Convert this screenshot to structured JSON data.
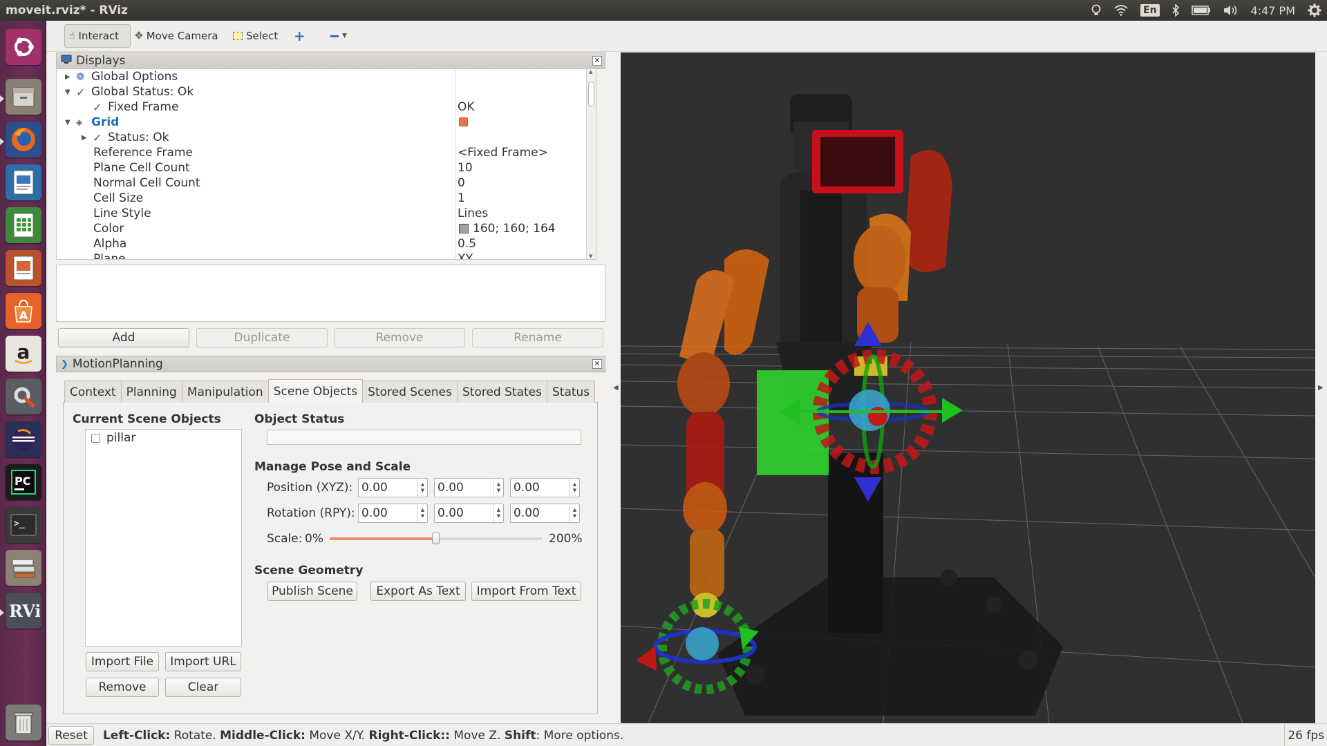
{
  "window": {
    "title": "moveit.rviz* - RViz"
  },
  "tray": {
    "lang": "En",
    "time": "4:47 PM"
  },
  "toolbar": {
    "interact": "Interact",
    "move_camera": "Move Camera",
    "select": "Select"
  },
  "displays": {
    "title": "Displays",
    "rows": [
      {
        "label": "Global Options",
        "value": ""
      },
      {
        "label": "Global Status: Ok",
        "value": ""
      },
      {
        "label": "Fixed Frame",
        "value": "OK"
      },
      {
        "label": "Grid",
        "value": ""
      },
      {
        "label": "Status: Ok",
        "value": ""
      },
      {
        "label": "Reference Frame",
        "value": "<Fixed Frame>"
      },
      {
        "label": "Plane Cell Count",
        "value": "10"
      },
      {
        "label": "Normal Cell Count",
        "value": "0"
      },
      {
        "label": "Cell Size",
        "value": "1"
      },
      {
        "label": "Line Style",
        "value": "Lines"
      },
      {
        "label": "Color",
        "value": "160; 160; 164"
      },
      {
        "label": "Alpha",
        "value": "0.5"
      },
      {
        "label": "Plane",
        "value": "XY"
      }
    ],
    "buttons": {
      "add": "Add",
      "duplicate": "Duplicate",
      "remove": "Remove",
      "rename": "Rename"
    }
  },
  "motion": {
    "title": "MotionPlanning",
    "tabs": [
      "Context",
      "Planning",
      "Manipulation",
      "Scene Objects",
      "Stored Scenes",
      "Stored States",
      "Status"
    ],
    "selected_tab": "Scene Objects",
    "current_objects_title": "Current Scene Objects",
    "objects": [
      "pillar"
    ],
    "object_status_title": "Object Status",
    "manage_title": "Manage Pose and Scale",
    "position_label": "Position (XYZ):",
    "rotation_label": "Rotation (RPY):",
    "position": [
      "0.00",
      "0.00",
      "0.00"
    ],
    "rotation": [
      "0.00",
      "0.00",
      "0.00"
    ],
    "scale_label": "Scale:",
    "scale_min": "0%",
    "scale_max": "200%",
    "scale_value_fraction": 0.5,
    "scene_geometry_title": "Scene Geometry",
    "publish_scene": "Publish Scene",
    "export_text": "Export As Text",
    "import_text": "Import From Text",
    "import_file": "Import File",
    "import_url": "Import URL",
    "remove": "Remove",
    "clear": "Clear"
  },
  "statusbar": {
    "reset": "Reset",
    "left_click": "Left-Click:",
    "left_click_action": " Rotate. ",
    "middle_click": "Middle-Click:",
    "middle_click_action": " Move X/Y. ",
    "right_click": "Right-Click::",
    "right_click_action": " Move Z. ",
    "shift": "Shift",
    "shift_action": ": More options.",
    "fps": "26 fps"
  },
  "colors": {
    "launcher": "#6a2f55",
    "viewport_bg": "#303030",
    "grid_color": "#a0a0a4",
    "slider_fill": "#f18b62",
    "check_green": "#2a7a2a",
    "link_blue": "#1f6fc0"
  }
}
